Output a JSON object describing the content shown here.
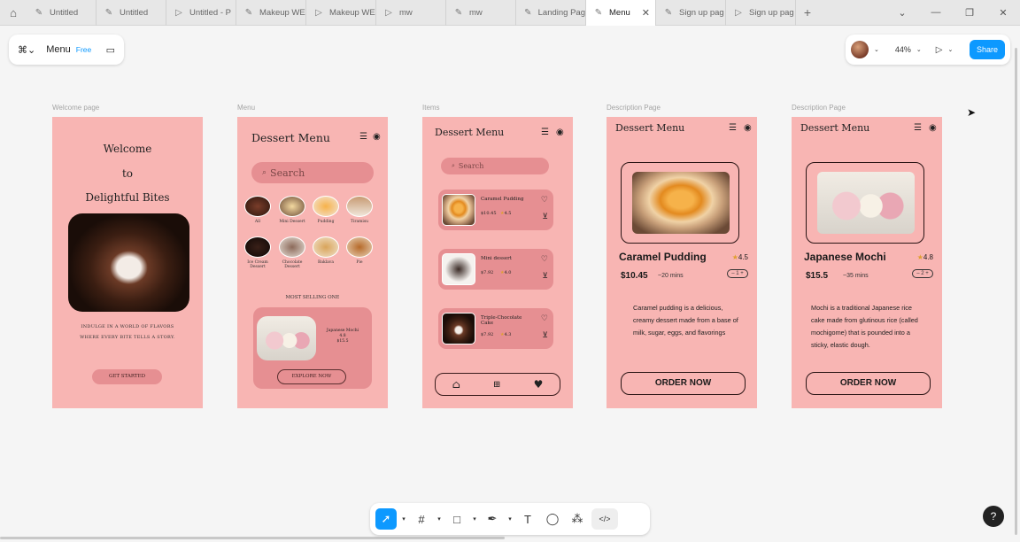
{
  "tabs": [
    {
      "label": "Untitled",
      "icon": "figma-icon"
    },
    {
      "label": "Untitled",
      "icon": "figma-icon"
    },
    {
      "label": "Untitled - P",
      "icon": "play-icon"
    },
    {
      "label": "Makeup WE",
      "icon": "figma-icon"
    },
    {
      "label": "Makeup WE",
      "icon": "play-icon"
    },
    {
      "label": "mw",
      "icon": "play-icon"
    },
    {
      "label": "mw",
      "icon": "figma-icon"
    },
    {
      "label": "Landing Pag",
      "icon": "figma-icon"
    },
    {
      "label": "Menu",
      "icon": "figma-icon",
      "active": true
    },
    {
      "label": "Sign up pag",
      "icon": "figma-icon"
    },
    {
      "label": "Sign up pag",
      "icon": "play-icon"
    }
  ],
  "header": {
    "file_name": "Menu",
    "plan_badge": "Free",
    "zoom": "44%",
    "share_label": "Share"
  },
  "frames": {
    "welcome": {
      "label": "Welcome page",
      "line1": "Welcome",
      "line2": "to",
      "line3": "Delightful Bites",
      "tagline1": "INDULGE IN A WORLD OF FLAVORS",
      "tagline2": "WHERE EVERY BITE TELLS A STORY.",
      "cta": "GET STARTED"
    },
    "menu": {
      "label": "Menu",
      "title": "Dessert Menu",
      "search_placeholder": "Search",
      "categories": [
        {
          "name": "All"
        },
        {
          "name": "Mini Dessert"
        },
        {
          "name": "Pudding"
        },
        {
          "name": "Tiramisu"
        },
        {
          "name": "Ice Cream Dessert"
        },
        {
          "name": "Chocolate Dessert"
        },
        {
          "name": "Baklava"
        },
        {
          "name": "Pie"
        }
      ],
      "section_title": "MOST SELLING ONE",
      "featured": {
        "name": "Japanese Mochi",
        "rating": "4.8",
        "price": "$15.5"
      },
      "explore": "EXPLORE NOW"
    },
    "items": {
      "label": "Items",
      "title": "Dessert Menu",
      "search_placeholder": "Search",
      "list": [
        {
          "name": "Caramel Pudding",
          "price": "$10.45",
          "rating": "4.5"
        },
        {
          "name": "Mini dessert",
          "price": "$7.92",
          "rating": "4.0"
        },
        {
          "name": "Triple-Chocolate Cake",
          "price": "$7.92",
          "rating": "4.3"
        }
      ]
    },
    "desc1": {
      "label": "Description Page",
      "title": "Dessert Menu",
      "name": "Caramel Pudding",
      "rating": "4.5",
      "price": "$10.45",
      "time": "~20 mins",
      "qty": "1",
      "description": "Caramel pudding is a delicious, creamy dessert made from a base of milk, sugar, eggs, and flavorings",
      "order": "ORDER NOW"
    },
    "desc2": {
      "label": "Description Page",
      "title": "Dessert Menu",
      "name": "Japanese Mochi",
      "rating": "4.8",
      "price": "$15.5",
      "time": "~35 mins",
      "qty": "2",
      "description": "Mochi is a traditional Japanese rice cake made from glutinous rice (called mochigome) that is pounded into a sticky, elastic dough.",
      "order": "ORDER NOW"
    }
  },
  "help_label": "?",
  "colors": {
    "frame_bg": "#f8b5b3",
    "accent_pink": "#e68f92",
    "figma_blue": "#0d99ff"
  }
}
